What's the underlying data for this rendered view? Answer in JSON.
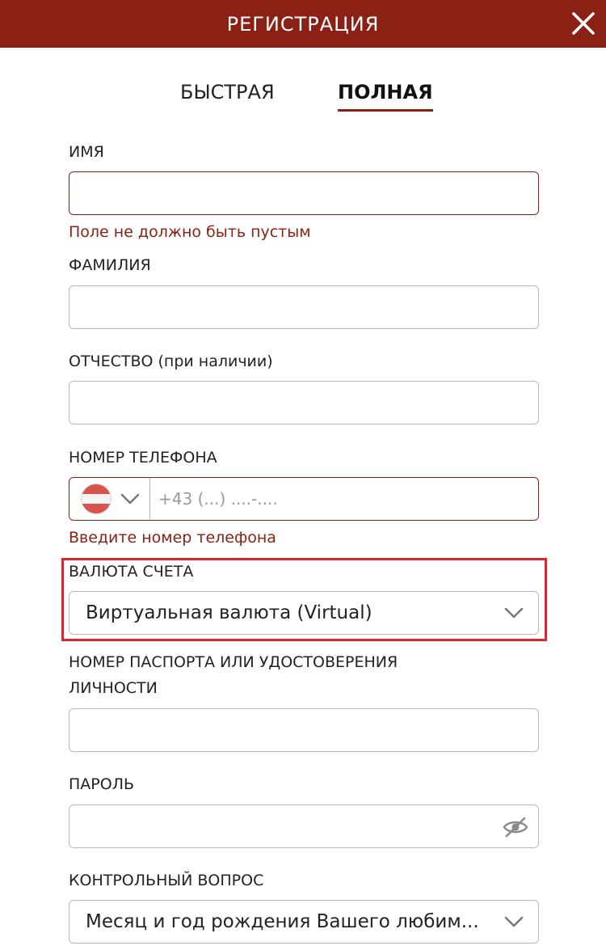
{
  "header": {
    "title": "РЕГИСТРАЦИЯ"
  },
  "tabs": [
    {
      "label": "БЫСТРАЯ",
      "active": false
    },
    {
      "label": "ПОЛНАЯ",
      "active": true
    }
  ],
  "form": {
    "first_name": {
      "label": "ИМЯ",
      "value": "",
      "error": "Поле не должно быть пустым"
    },
    "last_name": {
      "label": "ФАМИЛИЯ",
      "value": ""
    },
    "middle_name": {
      "label": "ОТЧЕСТВО (при наличии)",
      "value": ""
    },
    "phone": {
      "label": "НОМЕР ТЕЛЕФОНА",
      "placeholder": "+43 (...) ....-....",
      "country_flag": "austria-flag",
      "error": "Введите номер телефона"
    },
    "currency": {
      "label": "ВАЛЮТА СЧЕТА",
      "selected": "Виртуальная валюта (Virtual)"
    },
    "passport": {
      "label": "НОМЕР ПАСПОРТА ИЛИ УДОСТОВЕРЕНИЯ ЛИЧНОСТИ",
      "value": ""
    },
    "password": {
      "label": "ПАРОЛЬ",
      "value": ""
    },
    "security_question": {
      "label": "КОНТРОЛЬНЫЙ ВОПРОС",
      "selected": "Месяц и год рождения Вашего любим..."
    }
  },
  "colors": {
    "brand": "#8b2114",
    "highlight": "#d9252f",
    "error_text": "#8b2114",
    "border": "#b9b9b9"
  },
  "icons": {
    "close": "close-icon",
    "chevron": "chevron-down-icon",
    "eye": "eye-slash-icon"
  }
}
